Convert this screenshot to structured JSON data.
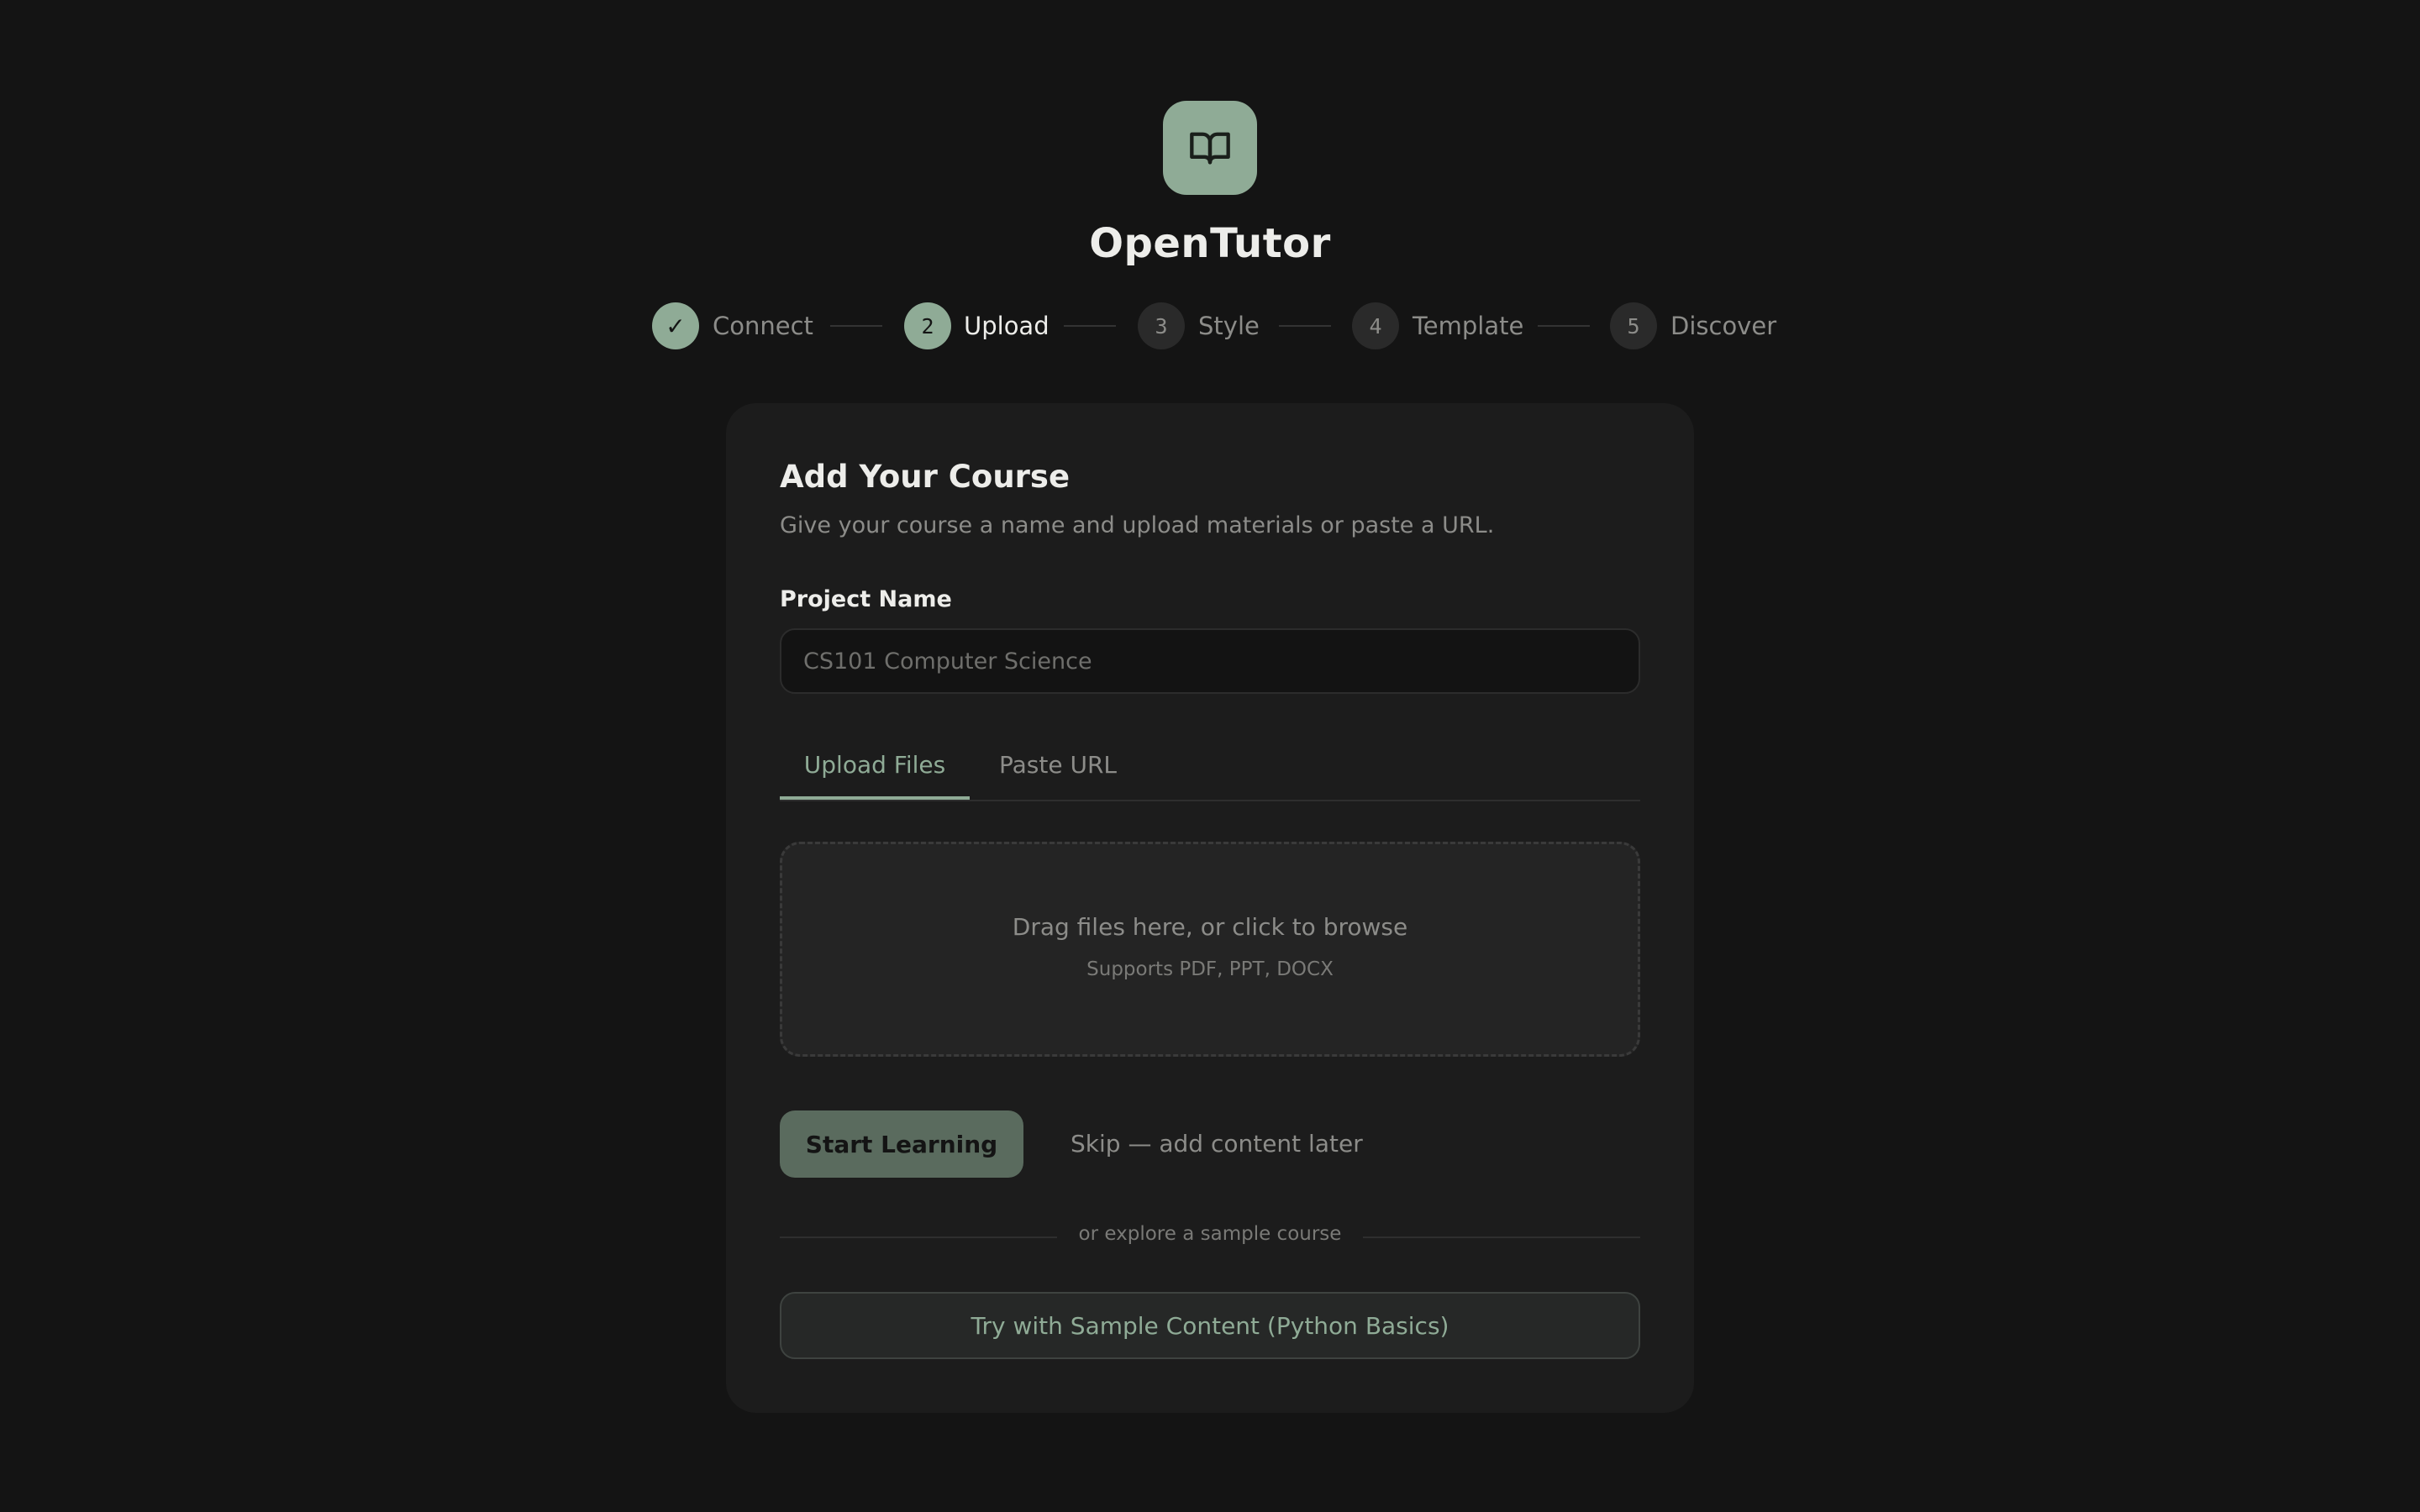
{
  "app": {
    "title": "OpenTutor",
    "logo_icon": "open-book-icon"
  },
  "stepper": {
    "steps": [
      {
        "marker": "✓",
        "label": "Connect",
        "state": "done"
      },
      {
        "marker": "2",
        "label": "Upload",
        "state": "active"
      },
      {
        "marker": "3",
        "label": "Style",
        "state": "pending"
      },
      {
        "marker": "4",
        "label": "Template",
        "state": "pending"
      },
      {
        "marker": "5",
        "label": "Discover",
        "state": "pending"
      }
    ]
  },
  "card": {
    "title": "Add Your Course",
    "subtitle": "Give your course a name and upload materials or paste a URL."
  },
  "project": {
    "label": "Project Name",
    "value": "",
    "placeholder": "CS101 Computer Science"
  },
  "tabs": [
    {
      "label": "Upload Files",
      "active": true
    },
    {
      "label": "Paste URL",
      "active": false
    }
  ],
  "dropzone": {
    "main": "Drag files here, or click to browse",
    "sub": "Supports PDF, PPT, DOCX"
  },
  "actions": {
    "start_label": "Start Learning",
    "skip_label": "Skip — add content later"
  },
  "divider": {
    "text": "or explore a sample course"
  },
  "sample": {
    "label": "Try with Sample Content (Python Basics)"
  },
  "colors": {
    "background": "#141414",
    "card": "#1c1c1c",
    "accent": "#8fab96",
    "primary_button": "#5a6b5e",
    "muted_text": "#8c8c89"
  }
}
